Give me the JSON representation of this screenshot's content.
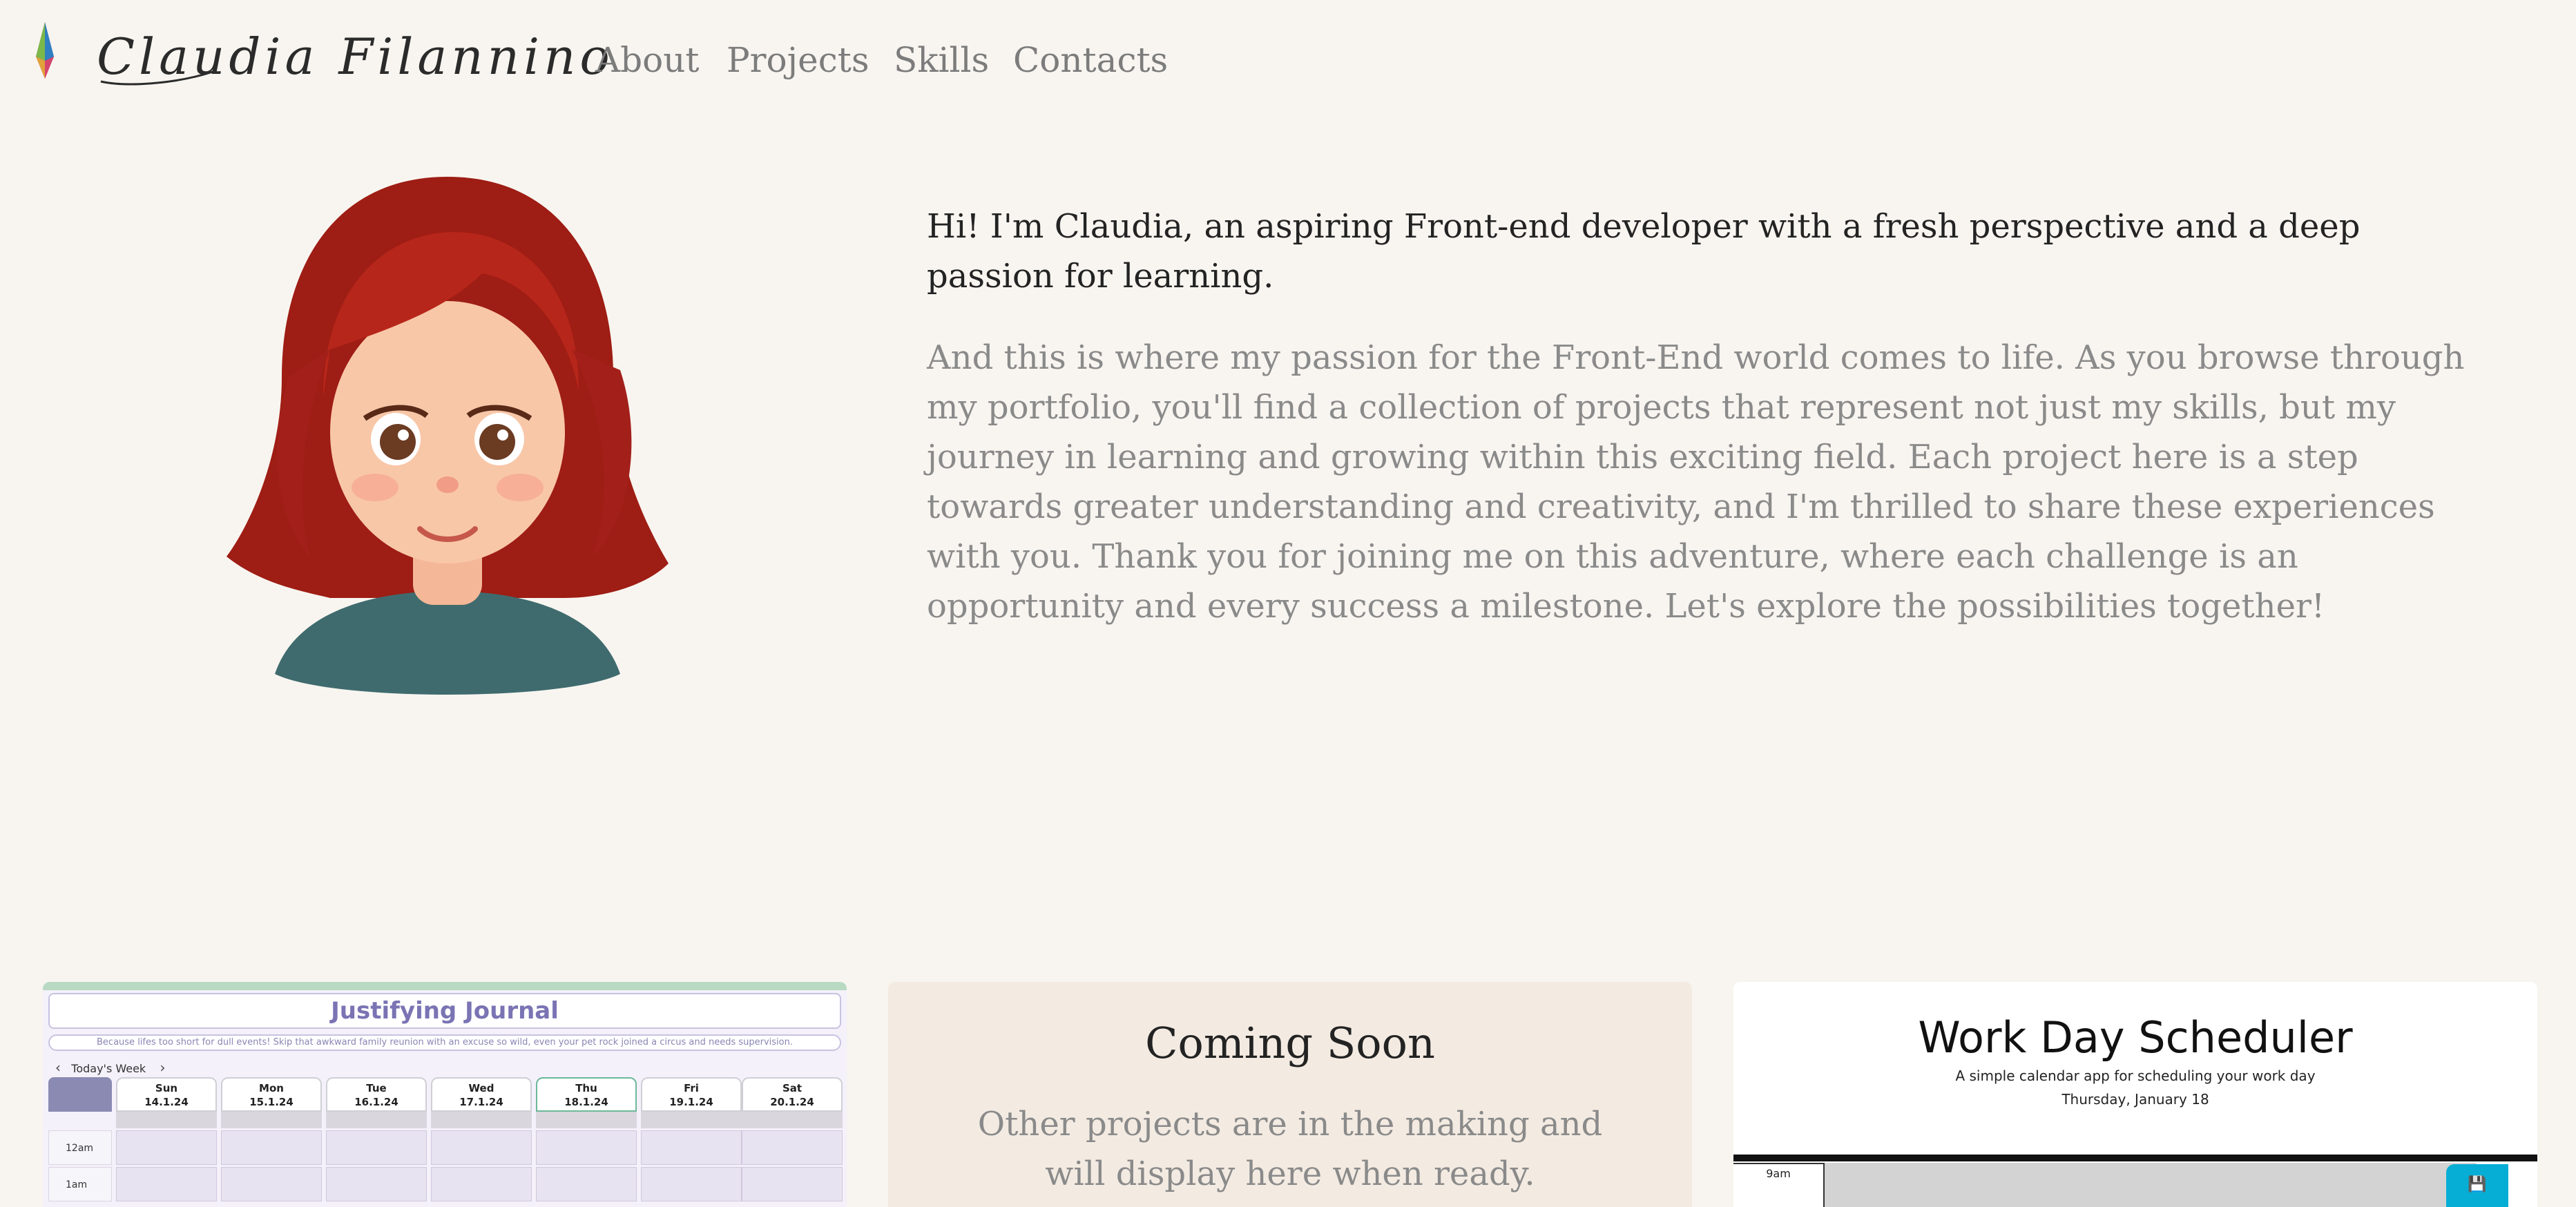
{
  "nav": {
    "brand": "Claudia Filannino",
    "links": [
      "About",
      "Projects",
      "Skills",
      "Contacts"
    ]
  },
  "hero": {
    "intro": "Hi! I'm Claudia, an aspiring Front-end developer with a fresh perspective and a deep passion for learning.",
    "body": "And this is where my passion for the Front-End world comes to life. As you browse through my portfolio, you'll find a collection of projects that represent not just my skills, but my journey in learning and growing within this exciting field. Each project here is a step towards greater understanding and creativity, and I'm thrilled to share these experiences with you. Thank you for joining me on this adventure, where each challenge is an opportunity and every success a milestone. Let's explore the possibilities together!"
  },
  "projects": {
    "journal": {
      "title": "Justifying Journal",
      "subtitle": "Because lifes too short for dull events! Skip that awkward family reunion with an excuse so wild, even your pet rock joined a circus and needs supervision.",
      "week_label": "Today's Week",
      "days": [
        {
          "day": "Sun",
          "date": "14.1.24"
        },
        {
          "day": "Mon",
          "date": "15.1.24"
        },
        {
          "day": "Tue",
          "date": "16.1.24"
        },
        {
          "day": "Wed",
          "date": "17.1.24"
        },
        {
          "day": "Thu",
          "date": "18.1.24"
        },
        {
          "day": "Fri",
          "date": "19.1.24"
        },
        {
          "day": "Sat",
          "date": "20.1.24"
        }
      ],
      "hours": [
        "12am",
        "1am"
      ]
    },
    "coming_soon": {
      "title": "Coming Soon",
      "body": "Other projects are in the making and will display here when ready."
    },
    "scheduler": {
      "title": "Work Day Scheduler",
      "subtitle": "A simple calendar app for scheduling your work day",
      "date": "Thursday, January 18",
      "first_hour": "9am"
    }
  },
  "colors": {
    "background": "#f8f5f0",
    "accent_purple": "#7a74b4",
    "save_button": "#06aed5"
  }
}
